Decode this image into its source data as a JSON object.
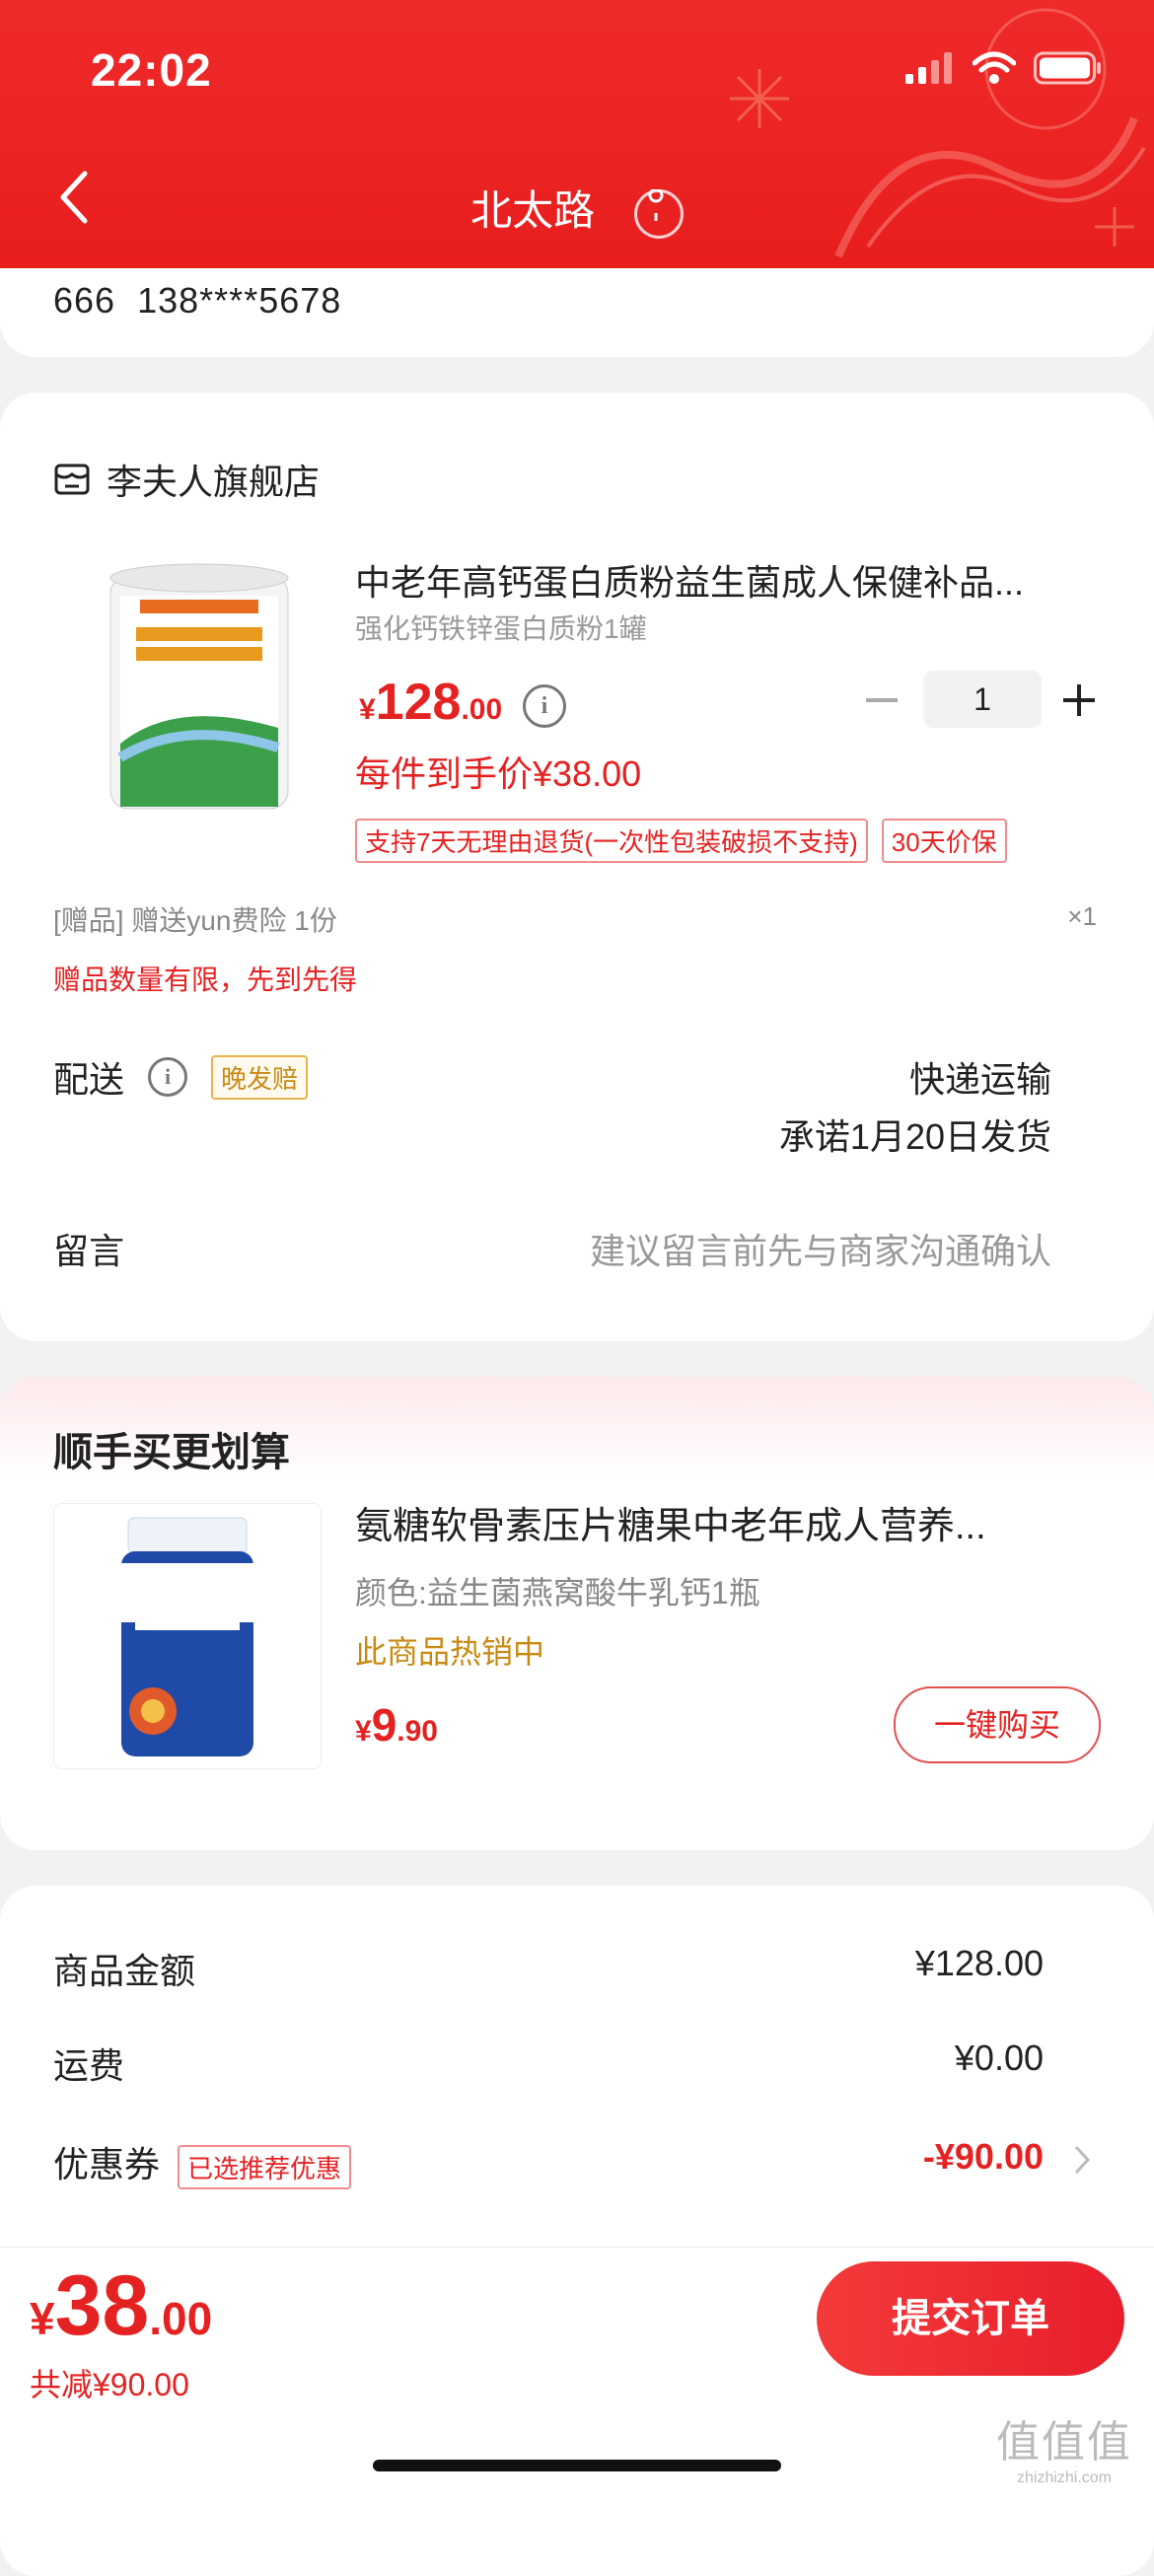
{
  "status": {
    "time": "22:02"
  },
  "nav": {
    "title": "北太路"
  },
  "address": {
    "name": "666",
    "phone": "138****5678"
  },
  "order": {
    "shop_name": "李夫人旗舰店",
    "product": {
      "title": "中老年高钙蛋白质粉益生菌成人保健补品...",
      "spec": "强化钙铁锌蛋白质粉1罐",
      "price_currency": "¥",
      "price_int": "128",
      "price_dec": ".00",
      "quantity": "1",
      "final_price": "每件到手价¥38.00",
      "tags": [
        "支持7天无理由退货(一次性包装破损不支持)",
        "30天价保"
      ]
    },
    "gift": {
      "text": "[赠品] 赠送yun费险 1份",
      "qty": "×1",
      "note": "赠品数量有限，先到先得"
    },
    "shipping": {
      "label": "配送",
      "late_tag": "晚发赔",
      "method": "快递运输",
      "promise": "承诺1月20日发货"
    },
    "message": {
      "label": "留言",
      "placeholder": "建议留言前先与商家沟通确认"
    }
  },
  "upsell": {
    "title": "顺手买更划算",
    "name": "氨糖软骨素压片糖果中老年成人营养...",
    "spec": "颜色:益生菌燕窝酸牛乳钙1瓶",
    "hot": "此商品热销中",
    "price_currency": "¥",
    "price_int": "9",
    "price_dec": ".90",
    "button": "一键购买"
  },
  "summary": {
    "goods_label": "商品金额",
    "goods_value": "¥128.00",
    "freight_label": "运费",
    "freight_value": "¥0.00",
    "coupon_label": "优惠券",
    "coupon_tag": "已选推荐优惠",
    "coupon_value": "-¥90.00"
  },
  "bottom": {
    "currency": "¥",
    "total_int": "38",
    "total_dec": ".00",
    "saved": "共减¥90.00",
    "submit": "提交订单"
  },
  "watermark": {
    "big": "值值值",
    "small": "zhizhizhi.com"
  },
  "colors": {
    "brand_red": "#e52222",
    "header_red": "#ef2a2a",
    "gold": "#c98a12"
  }
}
